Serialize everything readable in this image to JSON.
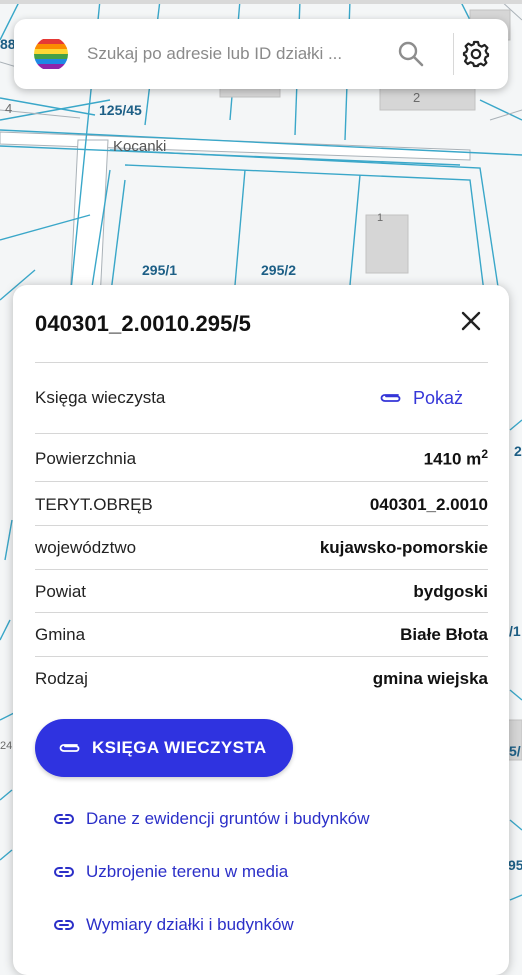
{
  "map": {
    "labels": {
      "l_88": "88",
      "l_4": "4",
      "l_125_45": "125/45",
      "l_2": "2",
      "l_kocanki": "Kocanki",
      "l_1": "1",
      "l_295_1": "295/1",
      "l_295_2": "295/2",
      "l_r2": "2",
      "l_r1": "/1",
      "l_24": "24",
      "l_r5": "5/",
      "l_95": "95"
    }
  },
  "search": {
    "placeholder": "Szukaj po adresie lub ID działki ...",
    "logo_icon": "rainbow-stripes-logo",
    "search_icon": "magnifier-icon",
    "settings_icon": "gear-icon"
  },
  "panel": {
    "title": "040301_2.0010.295/5",
    "close_icon": "close-icon",
    "ksiega": {
      "label": "Księga wieczysta",
      "link": "Pokaż"
    },
    "rows": [
      {
        "label": "Powierzchnia",
        "value": "1410 m",
        "sup": "2"
      },
      {
        "label": "TERYT.OBRĘB",
        "value": "040301_2.0010"
      },
      {
        "label": "województwo",
        "value": "kujawsko-pomorskie"
      },
      {
        "label": "Powiat",
        "value": "bydgoski"
      },
      {
        "label": "Gmina",
        "value": "Białe Błota"
      },
      {
        "label": "Rodzaj",
        "value": "gmina wiejska"
      }
    ],
    "primary_button": "KSIĘGA WIECZYSTA",
    "links": [
      "Dane z ewidencji gruntów i budynków",
      "Uzbrojenie terenu w media",
      "Wymiary działki i budynków"
    ]
  },
  "colors": {
    "accent": "#2f33e0",
    "link": "#2b2fc8",
    "parcel_line": "#3aa7c9",
    "map_label": "#1d5f86"
  }
}
